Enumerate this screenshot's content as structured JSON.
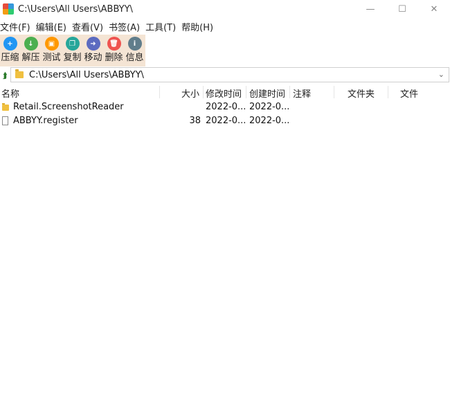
{
  "window": {
    "title": "C:\\Users\\All Users\\ABBYY\\",
    "minimize": "—",
    "maximize": "☐",
    "close": "✕"
  },
  "menu": [
    "文件(F)",
    "编辑(E)",
    "查看(V)",
    "书签(A)",
    "工具(T)",
    "帮助(H)"
  ],
  "toolbar": [
    {
      "label": "压缩",
      "icon": "compress-icon",
      "color": "#2196f3",
      "glyph": "+"
    },
    {
      "label": "解压",
      "icon": "extract-icon",
      "color": "#4caf50",
      "glyph": "↓"
    },
    {
      "label": "测试",
      "icon": "test-icon",
      "color": "#ff9800",
      "glyph": "▣"
    },
    {
      "label": "复制",
      "icon": "copy-icon",
      "color": "#26a69a",
      "glyph": "❐"
    },
    {
      "label": "移动",
      "icon": "move-icon",
      "color": "#5c6bc0",
      "glyph": "➜"
    },
    {
      "label": "删除",
      "icon": "delete-icon",
      "color": "#ef5350",
      "glyph": "🗑"
    },
    {
      "label": "信息",
      "icon": "info-icon",
      "color": "#607d8b",
      "glyph": "i"
    }
  ],
  "address": {
    "path": "C:\\Users\\All Users\\ABBYY\\",
    "up_icon": "up-folder-icon",
    "dropdown_icon": "chevron-down-icon"
  },
  "columns": {
    "name": "名称",
    "size": "大小",
    "modified": "修改时间",
    "created": "创建时间",
    "comment": "注释",
    "folders": "文件夹",
    "files": "文件"
  },
  "rows": [
    {
      "name": "Retail.ScreenshotReader",
      "size": "",
      "modified": "2022-0...",
      "created": "2022-0...",
      "type": "folder"
    },
    {
      "name": "ABBYY.register",
      "size": "38",
      "modified": "2022-0...",
      "created": "2022-0...",
      "type": "file"
    }
  ]
}
